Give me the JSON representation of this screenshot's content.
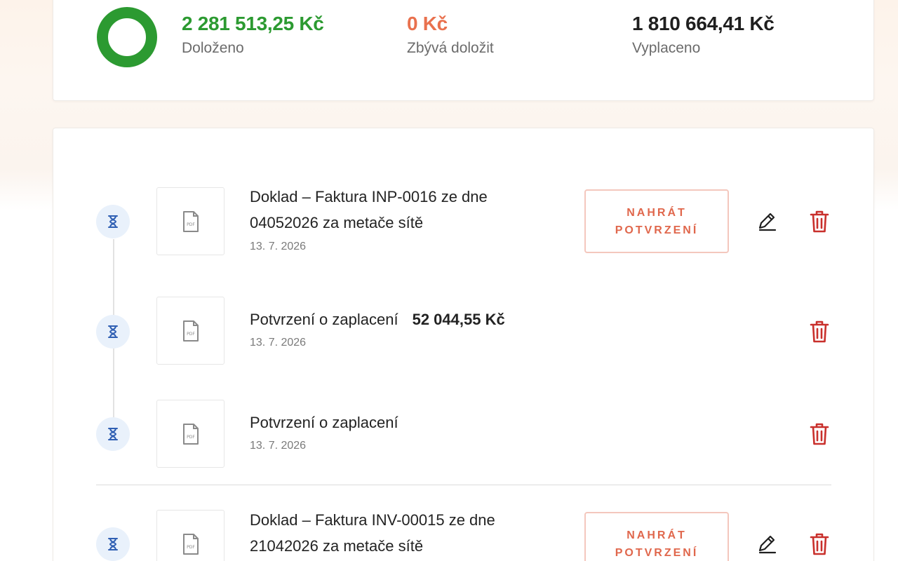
{
  "summary": {
    "stats": [
      {
        "value": "2 281 513,25 Kč",
        "label": "Doloženo",
        "color": "#2c9a31"
      },
      {
        "value": "0 Kč",
        "label": "Zbývá doložit",
        "color": "#e9714e"
      },
      {
        "value": "1 810 664,41 Kč",
        "label": "Vyplaceno",
        "color": "#1f1f1f"
      }
    ],
    "progress_fraction": 1.0,
    "donut_color": "#2c9a31"
  },
  "items": [
    {
      "title_line1": "Doklad – Faktura INP-0016 ze dne",
      "title_line2": "04052026 za metače sítě",
      "date": "13. 7. 2026",
      "upload_label_line1": "NAHRÁT",
      "upload_label_line2": "POTVRZENÍ",
      "status_icon": "hourglass-icon",
      "file_icon": "pdf-icon"
    },
    {
      "title_line1": "Potvrzení o zaplacení",
      "amount": "52 044,55 Kč",
      "date": "13. 7. 2026",
      "status_icon": "hourglass-icon",
      "file_icon": "pdf-icon"
    },
    {
      "title_line1": "Potvrzení o zaplacení",
      "date": "13. 7. 2026",
      "status_icon": "hourglass-icon",
      "file_icon": "pdf-icon"
    },
    {
      "title_line1": "Doklad – Faktura INV-00015 ze dne",
      "title_line2": "21042026 za metače sítě",
      "upload_label_line1": "NAHRÁT",
      "upload_label_line2": "POTVRZENÍ",
      "status_icon": "hourglass-icon",
      "file_icon": "pdf-icon"
    }
  ],
  "pdf_badge": "PDF",
  "colors": {
    "accent": "#e0674c",
    "delete": "#c9302c",
    "hourglass": "#2f5fb3"
  }
}
